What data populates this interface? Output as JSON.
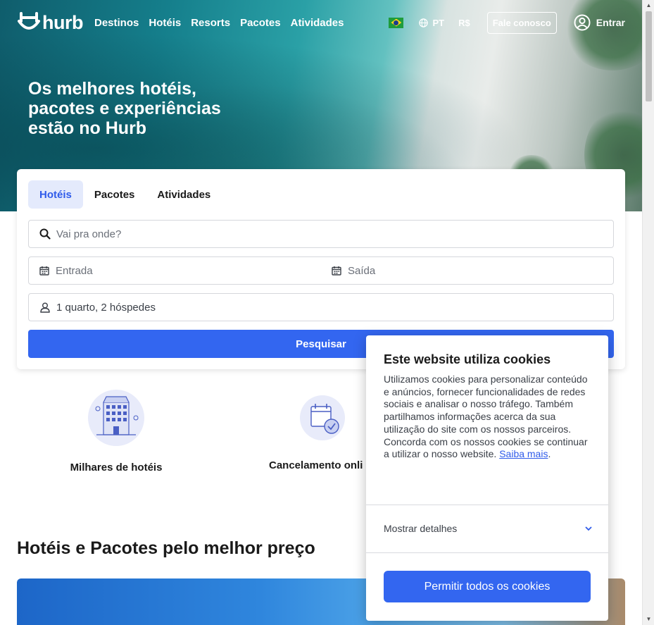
{
  "header": {
    "logo_text": "hurb",
    "nav": [
      "Destinos",
      "Hotéis",
      "Resorts",
      "Pacotes",
      "Atividades"
    ],
    "language": "PT",
    "currency": "R$",
    "contact_label": "Fale conosco",
    "login_label": "Entrar"
  },
  "hero": {
    "title": "Os melhores hotéis, pacotes e experiências estão no Hurb"
  },
  "search": {
    "tabs": [
      "Hotéis",
      "Pacotes",
      "Atividades"
    ],
    "active_tab": "Hotéis",
    "destination_placeholder": "Vai pra onde?",
    "checkin_placeholder": "Entrada",
    "checkout_placeholder": "Saída",
    "guests_value": "1 quarto, 2 hóspedes",
    "submit_label": "Pesquisar"
  },
  "features": [
    {
      "label": "Milhares de hotéis",
      "icon": "hotel-building-icon"
    },
    {
      "label": "Cancelamento onli",
      "icon": "calendar-check-icon"
    }
  ],
  "section": {
    "title": "Hotéis e Pacotes pelo melhor preço"
  },
  "cookie": {
    "title": "Este website utiliza cookies",
    "text": "Utilizamos cookies para personalizar conteúdo e anúncios, fornecer funcionalidades de redes sociais e analisar o nosso tráfego. Também partilhamos informações acerca da sua utilização do site com os nossos parceiros. Concorda com os nossos cookies se continuar a utilizar o nosso website.",
    "link_label": "Saiba mais",
    "details_label": "Mostrar detalhes",
    "allow_label": "Permitir todos os cookies"
  },
  "colors": {
    "primary": "#3366f0",
    "tab_active_bg": "#e4eafc",
    "link": "#2f5bea"
  }
}
